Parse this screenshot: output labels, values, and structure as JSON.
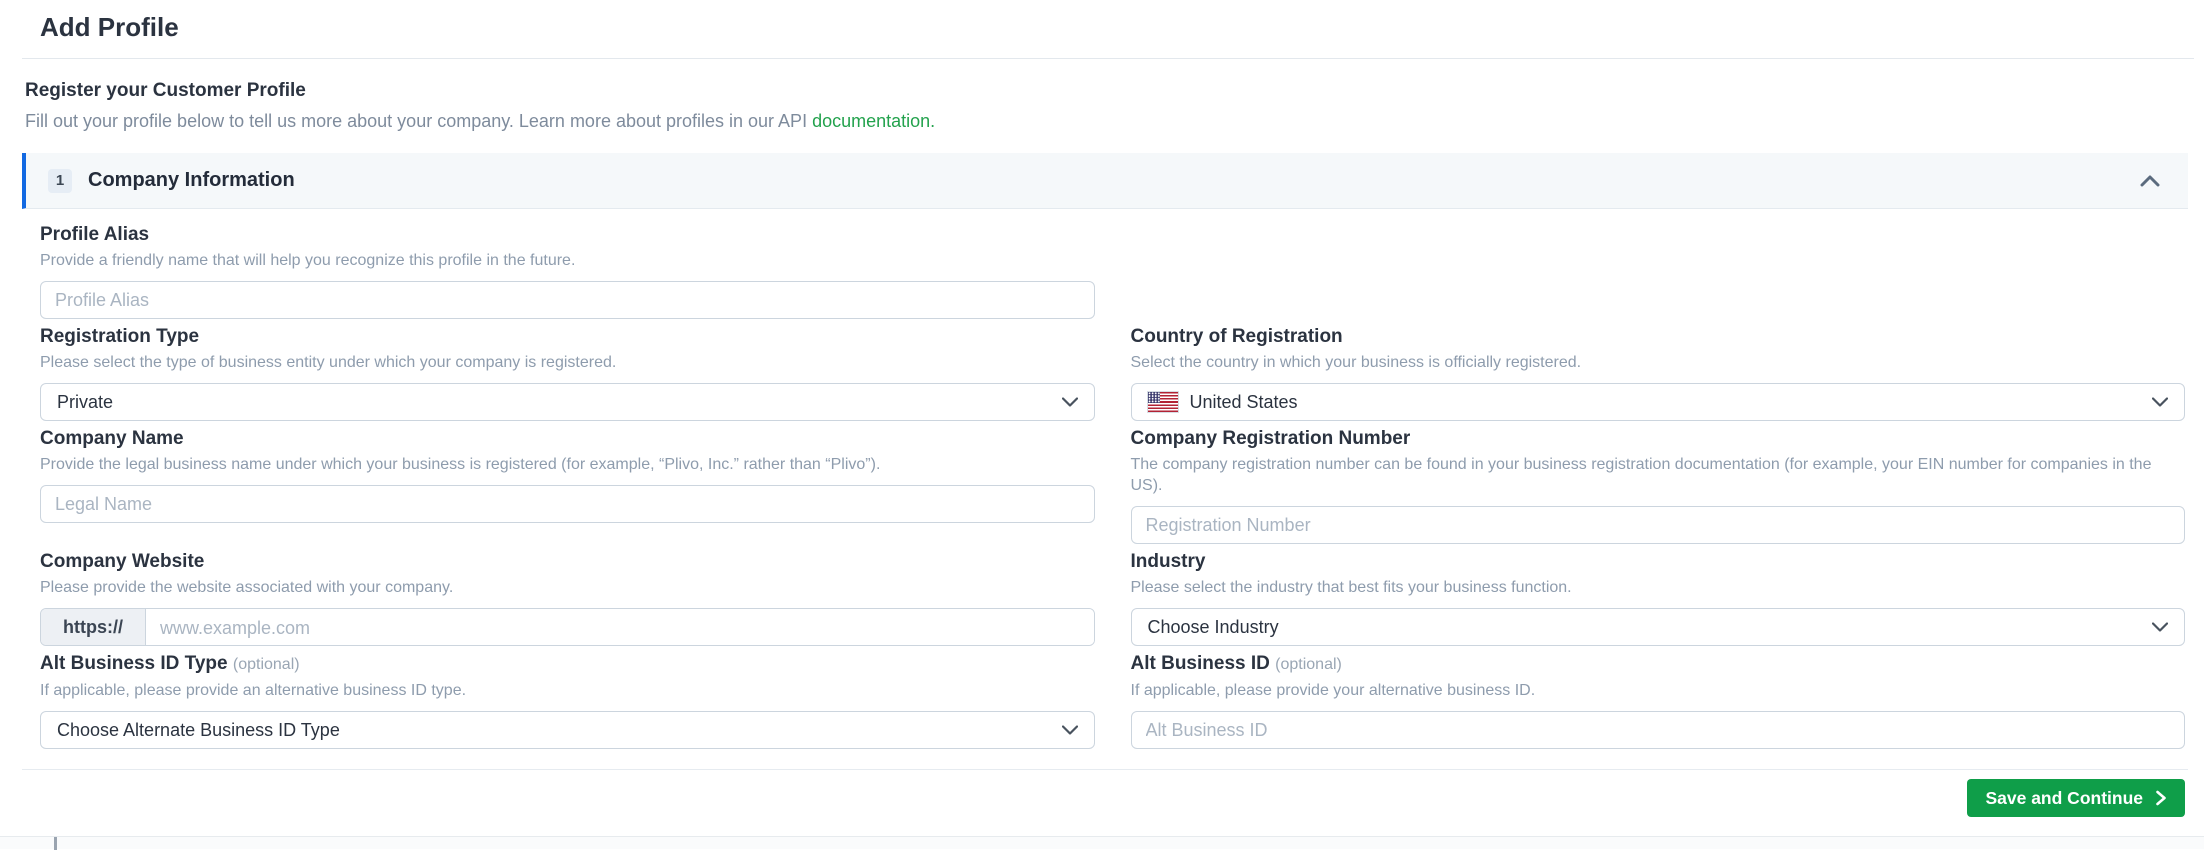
{
  "page": {
    "title": "Add Profile"
  },
  "intro": {
    "heading": "Register your Customer Profile",
    "description": "Fill out your profile below to tell us more about your company. Learn more about profiles in our API ",
    "link_text": "documentation."
  },
  "section": {
    "step_number": "1",
    "title": "Company Information"
  },
  "fields": {
    "profile_alias": {
      "label": "Profile Alias",
      "helper": "Provide a friendly name that will help you recognize this profile in the future.",
      "placeholder": "Profile Alias"
    },
    "registration_type": {
      "label": "Registration Type",
      "helper": "Please select the type of business entity under which your company is registered.",
      "value": "Private"
    },
    "country_of_registration": {
      "label": "Country of Registration",
      "helper": "Select the country in which your business is officially registered.",
      "value": "United States",
      "flag": "united-states"
    },
    "company_name": {
      "label": "Company Name",
      "helper": "Provide the legal business name under which your business is registered (for example, “Plivo, Inc.” rather than “Plivo”).",
      "placeholder": "Legal Name"
    },
    "company_registration_number": {
      "label": "Company Registration Number",
      "helper": "The company registration number can be found in your business registration documentation (for example, your EIN number for companies in the US).",
      "placeholder": "Registration Number"
    },
    "company_website": {
      "label": "Company Website",
      "helper": "Please provide the website associated with your company.",
      "prefix": "https://",
      "placeholder": "www.example.com"
    },
    "industry": {
      "label": "Industry",
      "helper": "Please select the industry that best fits your business function.",
      "value": "Choose Industry"
    },
    "alt_business_id_type": {
      "label": "Alt Business ID Type",
      "optional": "(optional)",
      "helper": "If applicable, please provide an alternative business ID type.",
      "value": "Choose Alternate Business ID Type"
    },
    "alt_business_id": {
      "label": "Alt Business ID",
      "optional": "(optional)",
      "helper": "If applicable, please provide your alternative business ID.",
      "placeholder": "Alt Business ID"
    }
  },
  "footer": {
    "save_button_label": "Save and Continue"
  },
  "colors": {
    "accent_blue": "#1269e2",
    "button_green": "#0f9e49",
    "link_green": "#23a24d"
  }
}
